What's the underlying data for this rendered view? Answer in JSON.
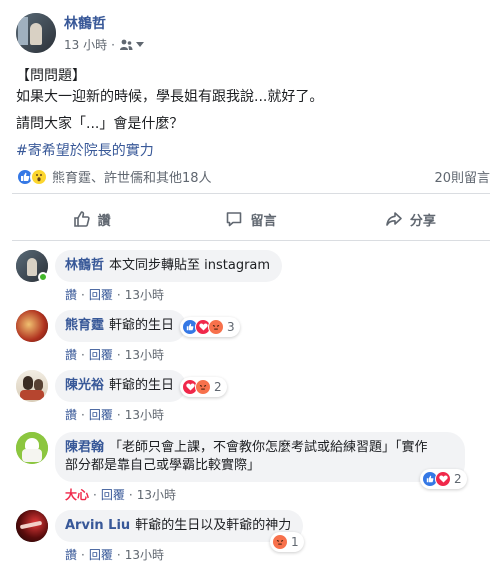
{
  "post": {
    "author": "林鶴哲",
    "time": "13 小時",
    "audience_icon": "friends-icon",
    "lines": [
      "【問問題】",
      "如果大一迎新的時候，學長姐有跟我說...就好了。",
      "請問大家「...」會是什麼？",
      "#寄希望於院長的實力"
    ],
    "reactions_text": "熊育霆、許世儒和其他18人",
    "comments_count": "20則留言"
  },
  "actions": {
    "like": "讚",
    "comment": "留言",
    "share": "分享"
  },
  "comments": [
    {
      "name": "林鶴哲",
      "text": "本文同步轉貼至 instagram",
      "like": "讚",
      "reply": "回覆",
      "time": "13小時",
      "reaction_count": ""
    },
    {
      "name": "熊育霆",
      "text": "軒爺的生日",
      "like": "讚",
      "reply": "回覆",
      "time": "13小時",
      "reaction_count": "3"
    },
    {
      "name": "陳光裕",
      "text": "軒爺的生日",
      "like": "讚",
      "reply": "回覆",
      "time": "13小時",
      "reaction_count": "2"
    },
    {
      "name": "陳君翰",
      "text_line1": "「老師只會上課，不會教你怎麼考試或給練習題」「實作",
      "text_line2": "部分都是靠自己或學霸比較實際」",
      "like": "大心",
      "reply": "回覆",
      "time": "13小時",
      "reaction_count": "2"
    },
    {
      "name": "Arvin Liu",
      "text": "軒爺的生日以及軒爺的神力",
      "like": "讚",
      "reply": "回覆",
      "time": "13小時",
      "reaction_count": "1"
    }
  ],
  "colors": {
    "link": "#385898",
    "like_blue": "#3578e5",
    "love_red": "#f0284a",
    "angry_orange": "#f7714c",
    "wow_yellow": "#fcd62f",
    "bubble_bg": "#f2f3f5"
  }
}
